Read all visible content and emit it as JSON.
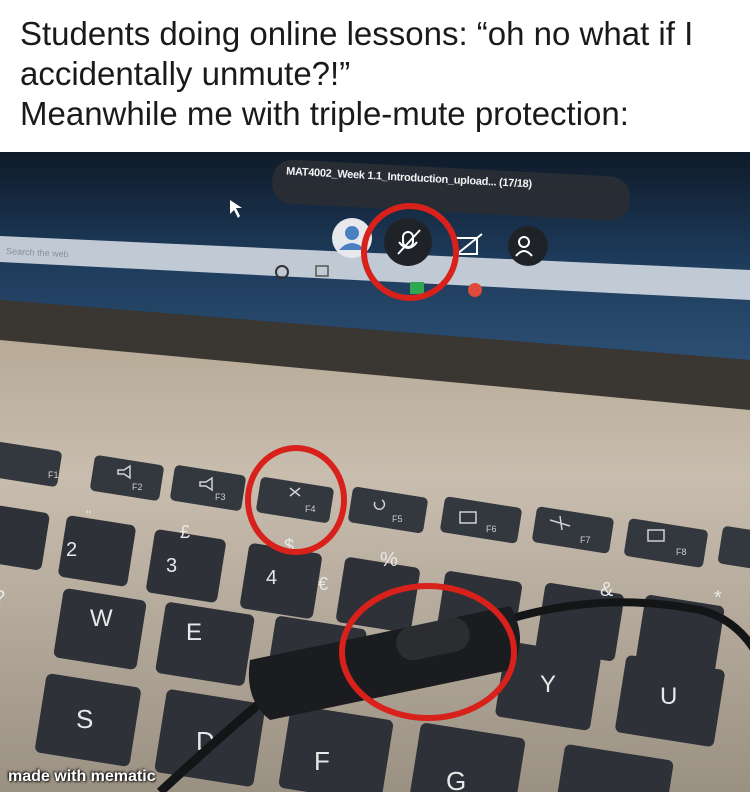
{
  "caption": {
    "line1": "Students doing online lessons: “oh no what if I",
    "line2": "accidentally unmute?!”",
    "line3": "Meanwhile me with triple-mute protection:"
  },
  "screen": {
    "meeting_title": "MAT4002_Week 1.1_Introduction_upload... (17/18)",
    "taskbar_search": "Search the web"
  },
  "keys": {
    "f1": "F1",
    "f2": "F2",
    "f3": "F3",
    "f4": "F4",
    "f5": "F5",
    "f6": "F6",
    "f7": "F7",
    "f8": "F8",
    "k2": "2",
    "k3": "3",
    "k4": "4",
    "pound": "£",
    "euro": "€",
    "dollar": "$",
    "percent": "%",
    "amp": "&",
    "star": "*",
    "w": "W",
    "e": "E",
    "d": "D",
    "s": "S",
    "f": "F",
    "g": "G",
    "y": "Y",
    "u": "U",
    "quote": "\"",
    "at": "?"
  },
  "watermark": "made with mematic",
  "annotation_color": "#d9211c"
}
